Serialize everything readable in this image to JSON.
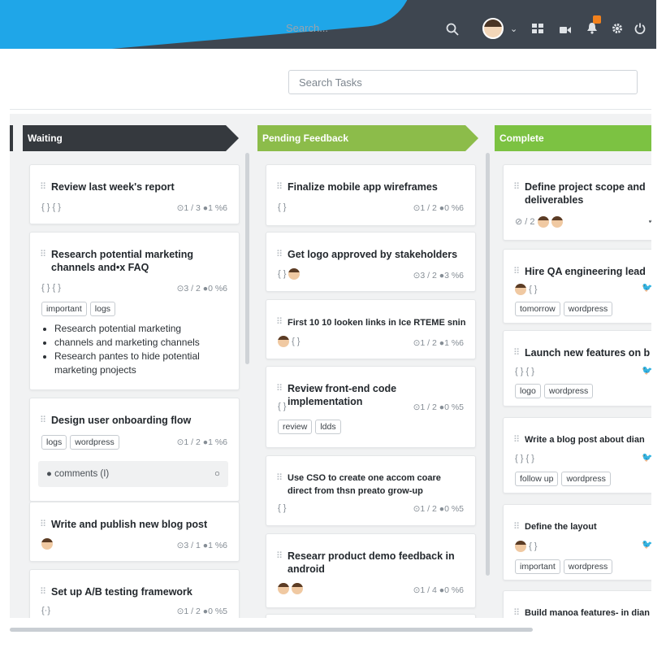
{
  "topbar": {
    "search_placeholder": "Search...",
    "icons": [
      "search-icon",
      "avatar",
      "chevron-down-icon",
      "grid-icon",
      "video-icon",
      "bell-icon",
      "gear-icon",
      "power-icon"
    ]
  },
  "toolbar": {
    "search_tasks_placeholder": "Search Tasks"
  },
  "columns": [
    {
      "name": "Waiting",
      "color": "#35393e"
    },
    {
      "name": "Pending Feedback",
      "color": "#8cbc4a"
    },
    {
      "name": "Complete",
      "color": "#7cc242"
    }
  ],
  "waiting": {
    "card1": {
      "title": "Review last week's report",
      "meta": "{ } { }",
      "stats": "⊙1 / 3 ●1 %6"
    },
    "card2": {
      "title": "Research potential marketing channels and•x FAQ",
      "meta": "{ } { }",
      "stats": "⊙3 / 2 ●0 %6",
      "tags": [
        "important",
        "logs"
      ],
      "bullets": [
        "Research potential marketing",
        "channels and marketing channels",
        "Research pantes to hide potential marketing pnojects"
      ]
    },
    "card3": {
      "title": "Design user onboarding flow",
      "tags": [
        "logs",
        "wordpress"
      ],
      "stats": "⊙1 / 2 ●1 %6",
      "comments": "comments (I)"
    },
    "card4": {
      "title": "Write and publish new blog post",
      "stats": "⊙3 / 1 ●1 %6"
    },
    "card5": {
      "title": "Set up A/B testing framework",
      "meta": "{·}",
      "stats": "⊙1 / 2 ●0 %5"
    }
  },
  "pending": {
    "card1": {
      "title": "Finalize mobile app wireframes",
      "meta": "{ }",
      "stats": "⊙1 / 2 ●0 %6"
    },
    "card2": {
      "title": "Get logo approved by stakeholders",
      "meta": "{ }",
      "stats": "⊙3 / 2 ●3 %6"
    },
    "card3": {
      "title": "First 10 10 looken links in Ice RTEME snin",
      "meta": "{ }",
      "stats": "⊙1 / 2 ●1 %6"
    },
    "card4": {
      "title": "Review front-end code implementation",
      "meta": "{ }",
      "stats": "⊙1 / 2 ●0 %5",
      "tags": [
        "review",
        "ldds"
      ]
    },
    "card5": {
      "title": "Use CSO to create one accom coare direct from thsn preato grow-up",
      "meta": "{ }",
      "stats": "⊙1 / 2 ●0 %5"
    },
    "card6": {
      "title": "Researr product demo feedback in android",
      "stats": "⊙1 / 4 ●0 %6"
    }
  },
  "complete": {
    "card1": {
      "title": "Define project scope and deliverables",
      "meta": "⊘ / 2"
    },
    "card2": {
      "title": "Hire QA engineering lead",
      "meta": "{ }",
      "tags": [
        "tomorrow",
        "wordpress"
      ]
    },
    "card3": {
      "title": "Launch new features on b",
      "meta": "{ } { }",
      "tags": [
        "logo",
        "wordpress"
      ]
    },
    "card4": {
      "title": "Write a blog post about dian",
      "meta": "{ } { }",
      "tags": [
        "follow up",
        "wordpress"
      ]
    },
    "card5": {
      "title": "Define the layout",
      "meta": "{ }",
      "tags": [
        "important",
        "wordpress"
      ]
    },
    "card6": {
      "title": "Build manoa features- in dian"
    }
  }
}
